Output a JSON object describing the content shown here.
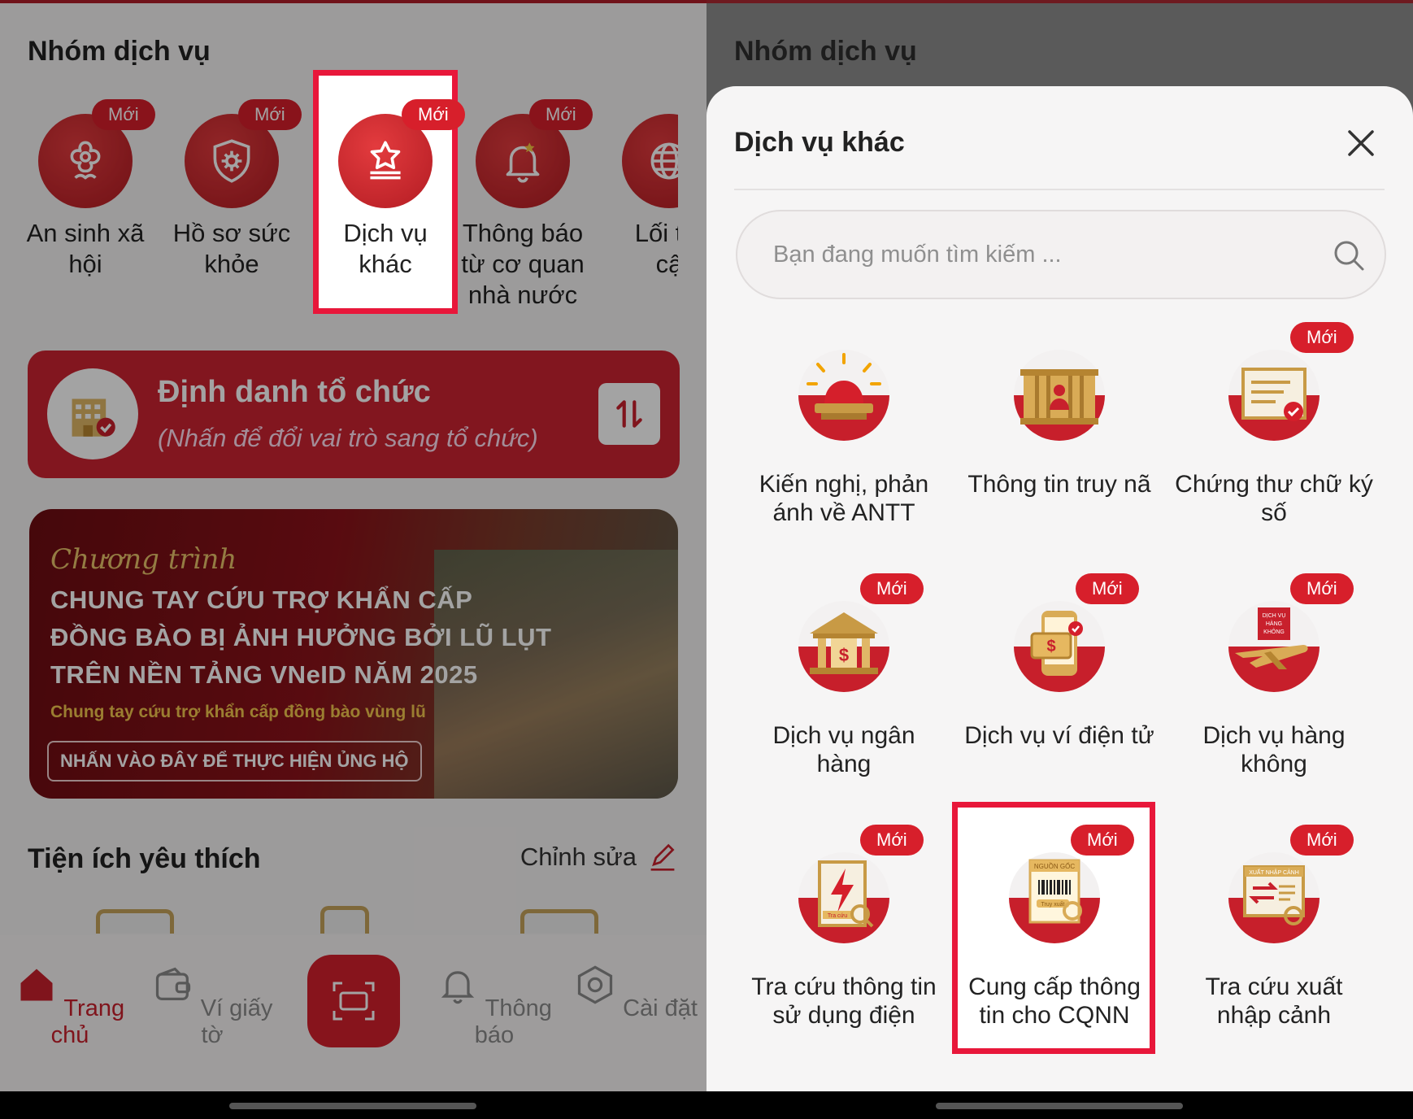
{
  "left": {
    "section_title": "Nhóm dịch vụ",
    "services": [
      {
        "label_1": "An sinh xã",
        "label_2": "hội",
        "badge": "Mới",
        "icon": "flower-hands-icon"
      },
      {
        "label_1": "Hồ sơ sức",
        "label_2": "khỏe",
        "badge": "Mới",
        "icon": "shield-virus-icon"
      },
      {
        "label_1": "Dịch vụ",
        "label_2": "khác",
        "badge": "Mới",
        "icon": "star-podium-icon"
      },
      {
        "label_1": "Thông báo",
        "label_2": "từ cơ quan",
        "label_3": "nhà nước",
        "badge": "Mới",
        "icon": "bell-star-icon"
      },
      {
        "label_1": "Lối tắt",
        "label_2": "cậ",
        "icon": "globe-icon"
      }
    ],
    "org": {
      "title": "Định danh tổ chức",
      "subtitle": "(Nhấn để đổi vai trò sang tổ chức)"
    },
    "campaign": {
      "script": "Chương trình",
      "line1": "CHUNG TAY CỨU TRỢ KHẨN CẤP",
      "line2": "ĐỒNG BÀO BỊ ẢNH HƯỞNG BỞI LŨ LỤT",
      "line3": "TRÊN NỀN TẢNG VNeID NĂM 2025",
      "tagline": "Chung tay cứu trợ khẩn cấp đồng bào vùng lũ",
      "cta": "NHẤN VÀO ĐÂY ĐỂ THỰC HIỆN ỦNG HỘ"
    },
    "favorites_title": "Tiện ích yêu thích",
    "edit_label": "Chỉnh sửa",
    "nav": {
      "home": "Trang chủ",
      "wallet": "Ví giấy tờ",
      "notifications": "Thông báo",
      "settings": "Cài đặt"
    }
  },
  "right": {
    "section_title": "Nhóm dịch vụ",
    "sheet_title": "Dịch vụ khác",
    "search_placeholder": "Bạn đang muốn tìm kiếm ...",
    "tiles": [
      {
        "label_1": "Kiến nghị, phản",
        "label_2": "ánh về ANTT",
        "icon": "siren-icon"
      },
      {
        "label_1": "Thông tin truy nã",
        "label_2": "",
        "icon": "jail-icon"
      },
      {
        "label_1": "Chứng thư chữ ký",
        "label_2": "số",
        "badge": "Mới",
        "icon": "certificate-icon"
      },
      {
        "label_1": "Dịch vụ ngân",
        "label_2": "hàng",
        "badge": "Mới",
        "icon": "bank-icon"
      },
      {
        "label_1": "Dịch vụ ví điện tử",
        "label_2": "",
        "badge": "Mới",
        "icon": "e-wallet-icon"
      },
      {
        "label_1": "Dịch vụ hàng",
        "label_2": "không",
        "badge": "Mới",
        "icon": "airplane-icon",
        "art_text": [
          "DỊCH VỤ",
          "HÀNG",
          "KHÔNG"
        ]
      },
      {
        "label_1": "Tra cứu thông tin",
        "label_2": "sử dụng điện",
        "badge": "Mới",
        "icon": "electricity-icon",
        "art_text": [
          "Tra cứu"
        ]
      },
      {
        "label_1": "Cung cấp thông",
        "label_2": "tin cho CQNN",
        "badge": "Mới",
        "icon": "barcode-origin-icon",
        "art_text": [
          "NGUỒN GỐC",
          "Truy xuất"
        ]
      },
      {
        "label_1": "Tra cứu xuất",
        "label_2": "nhập cảnh",
        "badge": "Mới",
        "icon": "immigration-icon",
        "art_text": [
          "XUẤT NHẬP CẢNH"
        ]
      }
    ]
  },
  "colors": {
    "brand_red": "#cc2331",
    "highlight": "#e8173a",
    "gold": "#c6a35b"
  }
}
